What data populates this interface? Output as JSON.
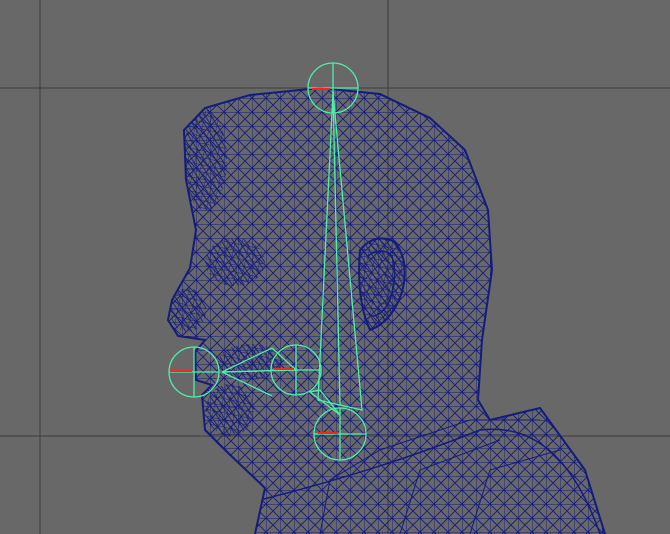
{
  "viewport": {
    "background": "#686868",
    "grid_color": "#3c3c3c",
    "mesh_color": "#141c7c",
    "joint_color": "#4cf0a8",
    "axis_color": "#ff2020"
  },
  "scene": {
    "subject": "head-wireframe-mesh",
    "joints": [
      {
        "name": "head-top-joint"
      },
      {
        "name": "jaw-joint"
      },
      {
        "name": "mouth-joint"
      },
      {
        "name": "lip-joint"
      }
    ]
  }
}
